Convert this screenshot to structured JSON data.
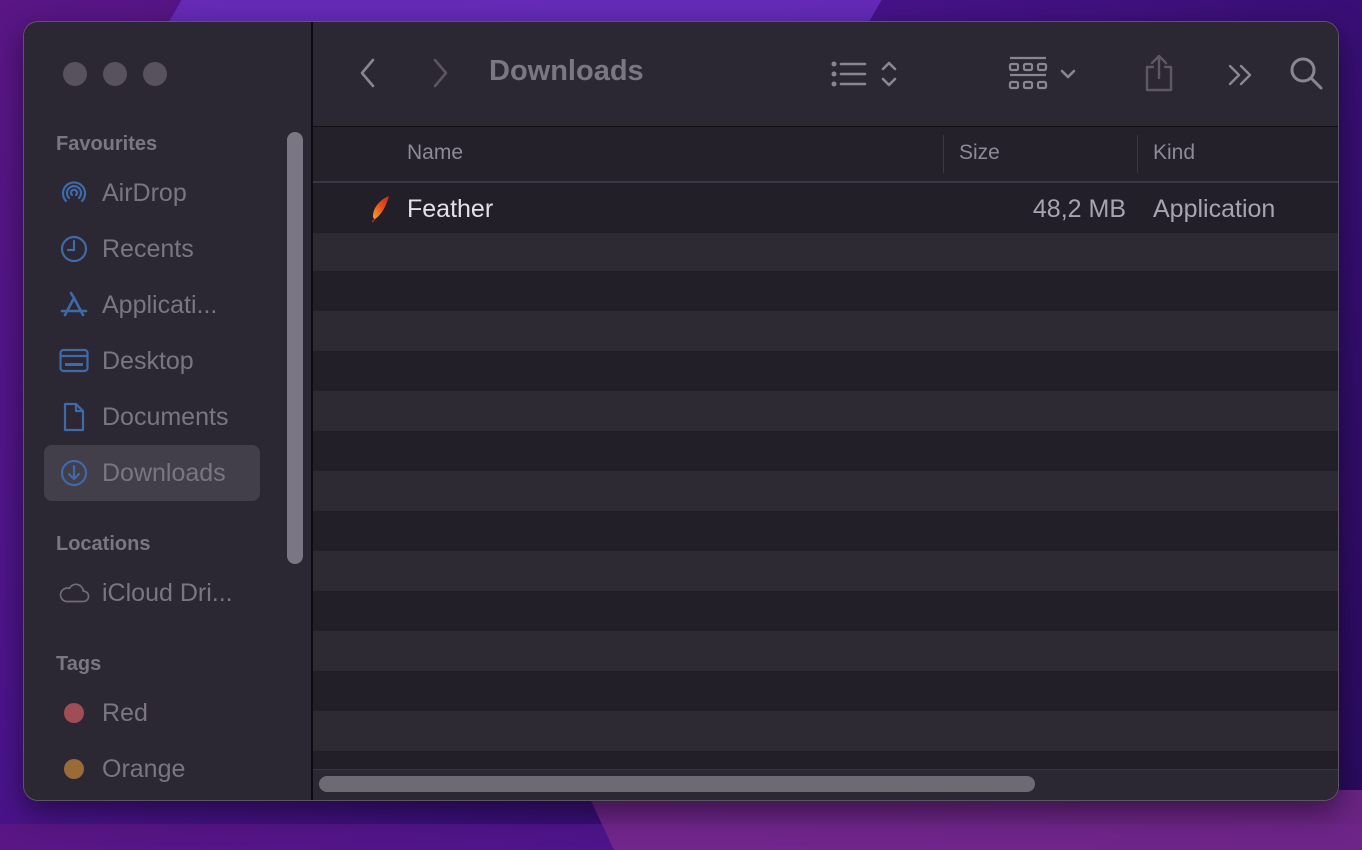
{
  "window": {
    "title": "Downloads"
  },
  "toolbar": {
    "back_icon": "chevron-left-icon",
    "forward_icon": "chevron-right-icon",
    "view_mode_icon": "list-view-icon",
    "sort_icon": "up-down-chevron-icon",
    "group_icon": "grid-group-icon",
    "group_chevron_icon": "chevron-down-icon",
    "share_icon": "share-icon",
    "more_icon": "double-chevron-right-icon",
    "search_icon": "search-icon"
  },
  "sidebar": {
    "sections": [
      {
        "title": "Favourites",
        "items": [
          {
            "label": "AirDrop",
            "icon": "airdrop-icon"
          },
          {
            "label": "Recents",
            "icon": "clock-icon"
          },
          {
            "label": "Applicati...",
            "icon": "applications-icon"
          },
          {
            "label": "Desktop",
            "icon": "desktop-icon"
          },
          {
            "label": "Documents",
            "icon": "document-icon"
          },
          {
            "label": "Downloads",
            "icon": "download-icon",
            "selected": true
          }
        ]
      },
      {
        "title": "Locations",
        "items": [
          {
            "label": "iCloud Dri...",
            "icon": "cloud-icon"
          }
        ]
      },
      {
        "title": "Tags",
        "items": [
          {
            "label": "Red",
            "color": "#a04e55"
          },
          {
            "label": "Orange",
            "color": "#9a6a38"
          }
        ]
      }
    ]
  },
  "table": {
    "columns": [
      "Name",
      "Size",
      "Kind"
    ],
    "rows": [
      {
        "name": "Feather",
        "size": "48,2 MB",
        "kind": "Application",
        "icon": "feather-app-icon"
      }
    ]
  },
  "colors": {
    "sidebar_icon": "#3d6aa8",
    "window_bg": "#2c2833",
    "list_bg": "#221f28"
  }
}
